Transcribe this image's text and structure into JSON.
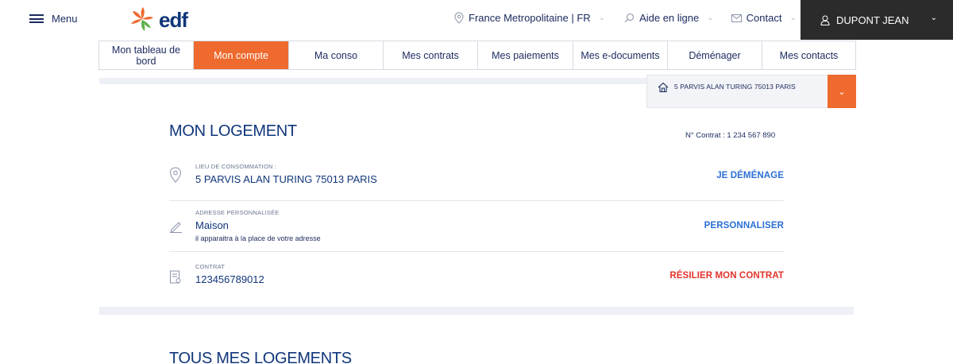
{
  "header": {
    "menu_label": "Menu",
    "logo_text": "edf",
    "region_label": "France Metropolitaine | FR",
    "help_label": "Aide en ligne",
    "contact_label": "Contact",
    "user_name": "DUPONT JEAN"
  },
  "tabs": [
    {
      "label": "Mon tableau de bord",
      "active": false
    },
    {
      "label": "Mon compte",
      "active": true
    },
    {
      "label": "Ma conso",
      "active": false
    },
    {
      "label": "Mes contrats",
      "active": false
    },
    {
      "label": "Mes paiements",
      "active": false
    },
    {
      "label": "Mes e-documents",
      "active": false
    },
    {
      "label": "Déménager",
      "active": false
    },
    {
      "label": "Mes contacts",
      "active": false
    }
  ],
  "address_selector": {
    "address": "5 PARVIS ALAN TURING 75013 PARIS"
  },
  "logement": {
    "title": "MON LOGEMENT",
    "contract_number": "N° Contrat : 1 234 567 890",
    "rows": [
      {
        "small_label": "LIEU DE CONSOMMATION :",
        "value": "5 PARVIS ALAN TURING 75013 PARIS",
        "action": "JE DÉMÉNAGE"
      },
      {
        "small_label": "ADRESSE PERSONNALISÉE",
        "value": "Maison",
        "sub": "il apparaitra à la place de votre adresse",
        "action": "PERSONNALISER"
      },
      {
        "small_label": "CONTRAT",
        "value": "123456789012",
        "action": "RÉSILIER MON CONTRAT"
      }
    ]
  },
  "next_section_title": "TOUS MES LOGEMENTS",
  "colors": {
    "brand_blue": "#10367a",
    "brand_orange": "#ee6a2e",
    "link_blue": "#2a6fd6",
    "danger_red": "#e2322a",
    "user_box_bg": "#2b2b2b"
  }
}
